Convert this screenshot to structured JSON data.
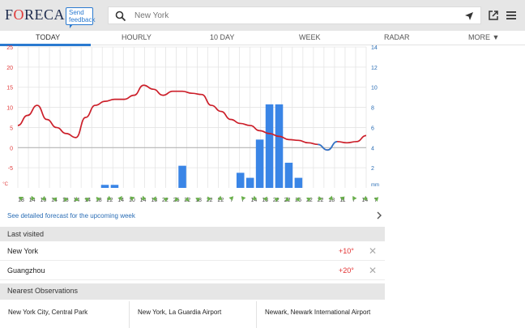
{
  "header": {
    "logo": {
      "pre": "F",
      "o": "O",
      "post": "RECA"
    },
    "feedback_label_1": "Send",
    "feedback_label_2": "feedback",
    "search_placeholder": "New York"
  },
  "tabs": [
    {
      "label": "TODAY",
      "active": true
    },
    {
      "label": "HOURLY",
      "active": false
    },
    {
      "label": "10 DAY",
      "active": false
    },
    {
      "label": "WEEK",
      "active": false
    },
    {
      "label": "RADAR",
      "active": false
    },
    {
      "label": "MORE ▼",
      "active": false
    }
  ],
  "chart_data": {
    "type": "line",
    "left_axis": {
      "ticks": [
        25,
        20,
        15,
        10,
        5,
        0,
        -5
      ],
      "unit": "°C",
      "ylim": [
        -10,
        25
      ]
    },
    "right_axis": {
      "ticks": [
        14,
        12,
        10,
        8,
        6,
        4,
        2
      ],
      "unit": "mm",
      "ylim": [
        0,
        14
      ]
    },
    "x_labels": [
      "18",
      "14",
      "10",
      "14",
      "18",
      "14",
      "14",
      "18",
      "22",
      "14",
      "10",
      "14",
      "18",
      "22",
      "25",
      "22",
      "18",
      "22",
      "22",
      "7",
      "7",
      "14",
      "18",
      "22",
      "22",
      "25",
      "22",
      "22",
      "18",
      "11",
      "7",
      "14",
      "7"
    ],
    "temperature": {
      "name": "",
      "values": [
        5.5,
        8,
        10.5,
        7,
        5,
        3.5,
        2.5,
        7.5,
        10.5,
        11.5,
        12,
        12,
        13,
        15.5,
        14.5,
        13,
        14,
        14,
        13.5,
        13.2,
        10.5,
        9,
        7,
        6,
        5.5,
        4.2,
        3.5,
        2.8,
        2,
        1.8,
        1.2,
        0.8,
        -0.6,
        1.5,
        1.2,
        1.5,
        3
      ]
    },
    "precipitation": {
      "name": "",
      "values": [
        0,
        0,
        0,
        0,
        0,
        0,
        0,
        0,
        0,
        0.3,
        0.3,
        0,
        0,
        0,
        0,
        0,
        0,
        2.2,
        0,
        0,
        0,
        0,
        0,
        1.5,
        1,
        4.8,
        8.3,
        8.3,
        2.5,
        1,
        0,
        0,
        0,
        0,
        0,
        0,
        0
      ]
    },
    "grid": true,
    "legend": "none"
  },
  "link": {
    "detailed_forecast": "See detailed forecast for the upcoming week"
  },
  "last_visited": {
    "title": "Last visited",
    "items": [
      {
        "city": "New York",
        "temp": "+10°"
      },
      {
        "city": "Guangzhou",
        "temp": "+20°"
      }
    ],
    "remove_glyph": "✕"
  },
  "nearest": {
    "title": "Nearest Observations",
    "items": [
      {
        "name": "New York City, Central Park"
      },
      {
        "name": "New York, La Guardia Airport"
      },
      {
        "name": "Newark, Newark International Airport"
      }
    ]
  },
  "colors": {
    "temp_line": "#cc1f2a",
    "temp_below_zero": "#2a7ad0",
    "precip_bar": "#3a85e6",
    "accent": "#2a7ad0",
    "header_bg": "#e6e6e6"
  },
  "icons": [
    "search-icon",
    "locate-icon",
    "external-link-icon",
    "menu-icon",
    "wind-arrow-icon",
    "chevron-right-icon",
    "close-icon"
  ]
}
